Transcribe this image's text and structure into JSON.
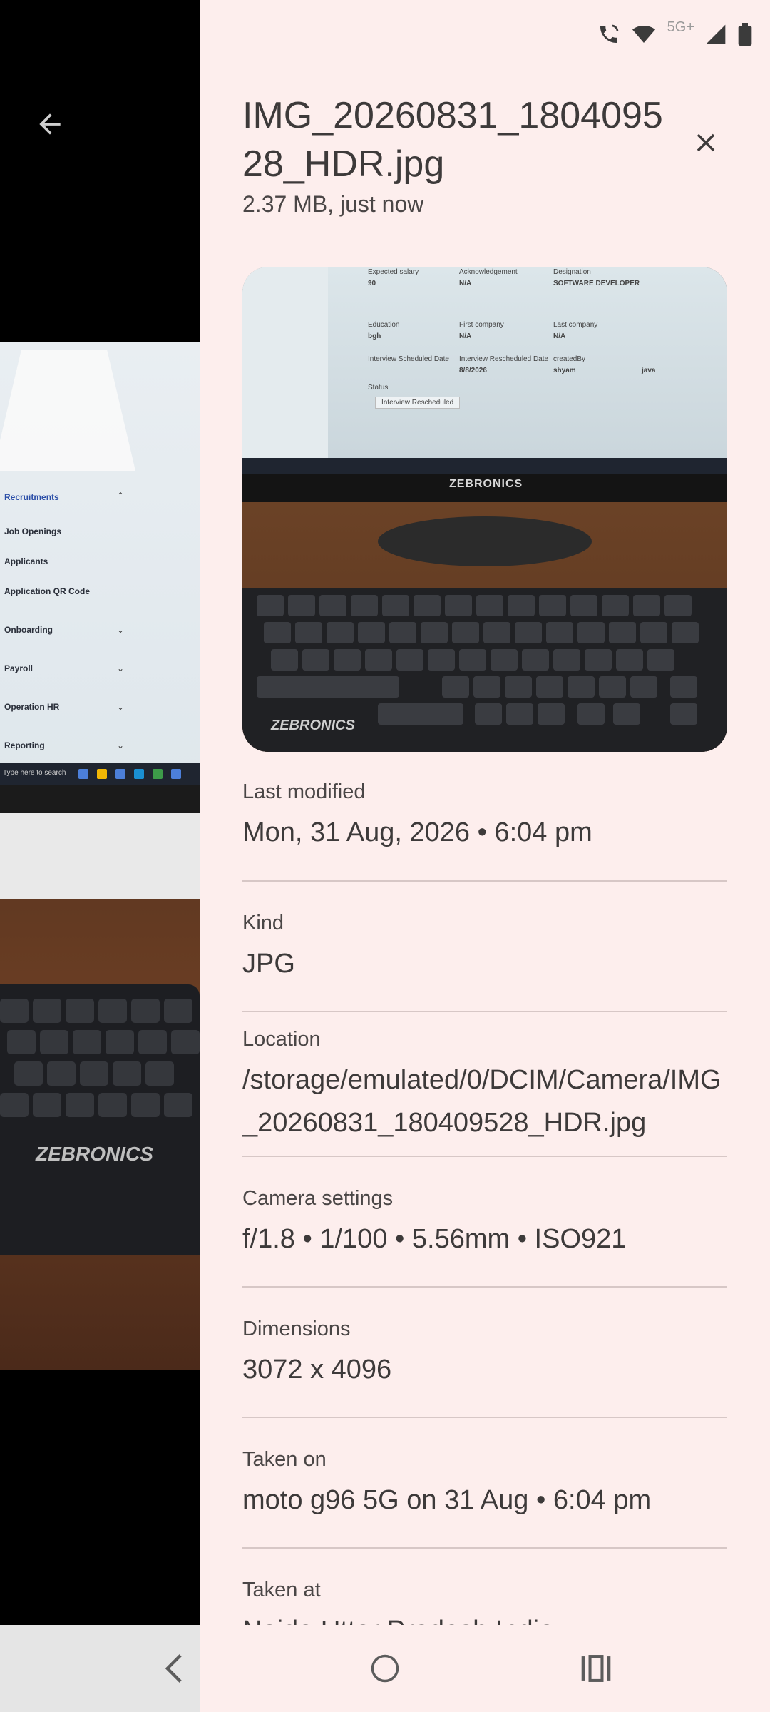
{
  "status_bar": {
    "network": "5G+"
  },
  "viewer": {
    "menu_items": [
      "Recruitments",
      "Job Openings",
      "Applicants",
      "Application QR Code",
      "Onboarding",
      "Payroll",
      "Operation HR",
      "Reporting"
    ],
    "taskbar_search": "Type here to search",
    "keyboard_brand": "ZEBRONICS"
  },
  "sheet": {
    "title": "IMG_20260831_180409528_HDR.jpg",
    "subtitle": "2.37 MB, just now",
    "thumbnail": {
      "headers": [
        "Expected salary",
        "Acknowledgement",
        "Designation",
        "Education",
        "First company",
        "Last company",
        "Interview Scheduled Date",
        "Interview Rescheduled Date",
        "createdBy",
        "Status"
      ],
      "values": [
        "90",
        "N/A",
        "SOFTWARE DEVELOPER",
        "bgh",
        "N/A",
        "N/A",
        "8/8/2026",
        "shyam",
        "java",
        "Interview Rescheduled"
      ],
      "monitor_brand": "ZEBRONICS",
      "keyboard_brand": "ZEBRONICS"
    },
    "details": [
      {
        "label": "Last modified",
        "value": "Mon, 31 Aug, 2026 • 6:04 pm"
      },
      {
        "label": "Kind",
        "value": "JPG"
      },
      {
        "label": "Location",
        "value": "/storage/emulated/0/DCIM/Camera/IMG_20260831_180409528_HDR.jpg"
      },
      {
        "label": "Camera settings",
        "value": "f/1.8 • 1/100 • 5.56mm • ISO921"
      },
      {
        "label": "Dimensions",
        "value": "3072 x 4096"
      },
      {
        "label": "Taken on",
        "value": "moto g96 5G on 31 Aug • 6:04 pm"
      },
      {
        "label": "Taken at",
        "value": "Noida Uttar Pradesh India"
      }
    ]
  },
  "icons": {
    "back": "arrow-back-icon",
    "close": "close-icon",
    "nav_back": "nav-back-icon",
    "nav_home": "nav-home-icon",
    "nav_recents": "nav-recents-icon"
  }
}
